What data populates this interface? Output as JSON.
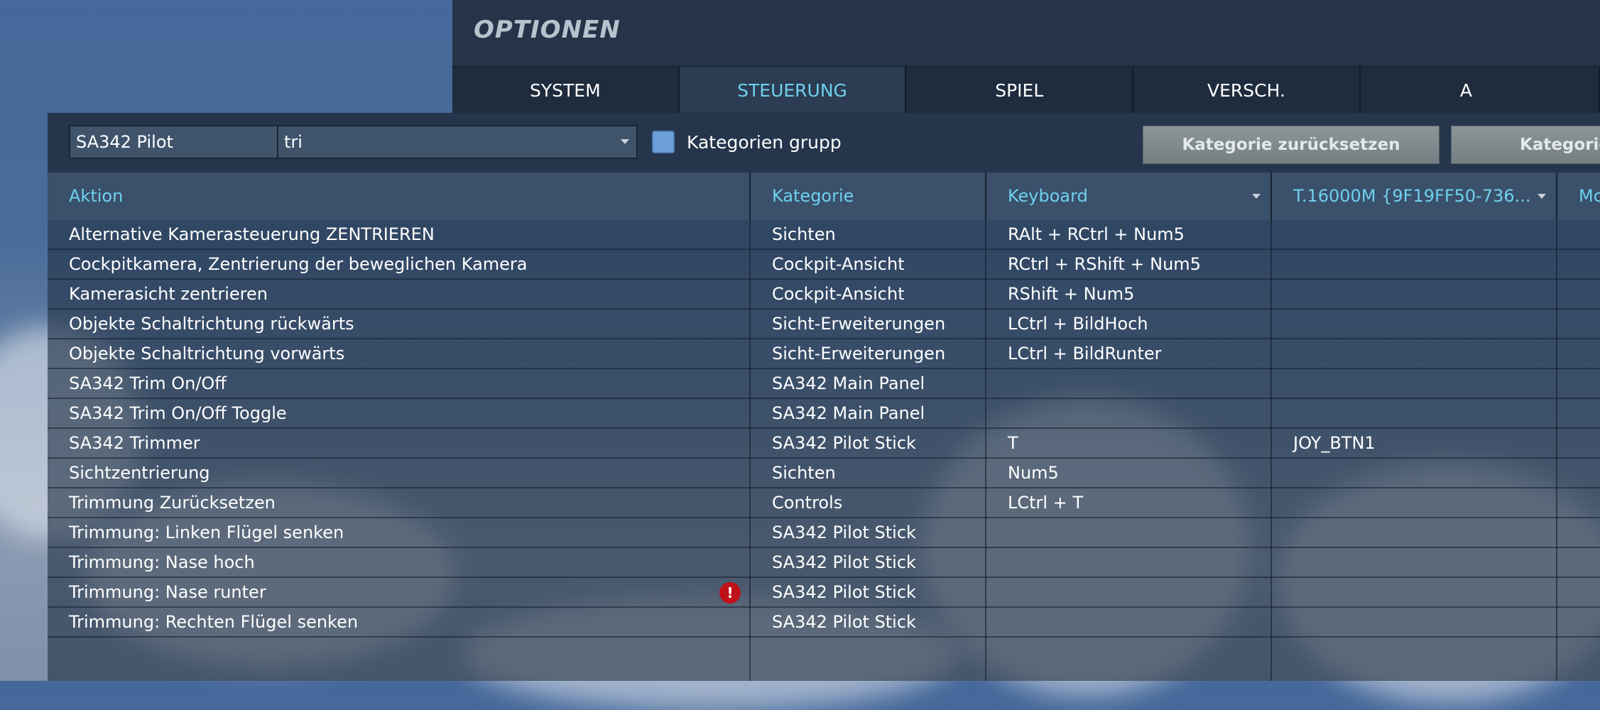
{
  "header": {
    "title": "OPTIONEN"
  },
  "tabs": [
    {
      "label": "SYSTEM",
      "active": false
    },
    {
      "label": "STEUERUNG",
      "active": true
    },
    {
      "label": "SPIEL",
      "active": false
    },
    {
      "label": "VERSCH.",
      "active": false
    },
    {
      "label": "A",
      "active": false
    }
  ],
  "toolbar": {
    "aircraft_select": "SA342 Pilot",
    "filter_select": "tri",
    "group_checkbox_label": "Kategorien grupp",
    "group_checkbox_checked": false,
    "reset_category_button": "Kategorie zurücksetzen",
    "second_category_button": "Kategorie"
  },
  "table": {
    "columns": [
      "Aktion",
      "Kategorie",
      "Keyboard",
      "T.16000M {9F19FF50-736...",
      "Mc"
    ],
    "rows": [
      {
        "action": "Alternative Kamerasteuerung ZENTRIEREN",
        "category": "Sichten",
        "keyboard": "RAlt + RCtrl + Num5",
        "joystick": "",
        "warning": false
      },
      {
        "action": "Cockpitkamera, Zentrierung der beweglichen Kamera",
        "category": "Cockpit-Ansicht",
        "keyboard": "RCtrl + RShift + Num5",
        "joystick": "",
        "warning": false
      },
      {
        "action": "Kamerasicht zentrieren",
        "category": "Cockpit-Ansicht",
        "keyboard": "RShift + Num5",
        "joystick": "",
        "warning": false
      },
      {
        "action": "Objekte Schaltrichtung rückwärts",
        "category": "Sicht-Erweiterungen",
        "keyboard": "LCtrl + BildHoch",
        "joystick": "",
        "warning": false
      },
      {
        "action": "Objekte Schaltrichtung vorwärts",
        "category": "Sicht-Erweiterungen",
        "keyboard": "LCtrl + BildRunter",
        "joystick": "",
        "warning": false
      },
      {
        "action": "SA342 Trim On/Off",
        "category": "SA342 Main Panel",
        "keyboard": "",
        "joystick": "",
        "warning": false
      },
      {
        "action": "SA342 Trim On/Off Toggle",
        "category": "SA342 Main Panel",
        "keyboard": "",
        "joystick": "",
        "warning": false
      },
      {
        "action": "SA342 Trimmer",
        "category": "SA342 Pilot Stick",
        "keyboard": "T",
        "joystick": "JOY_BTN1",
        "warning": false
      },
      {
        "action": "Sichtzentrierung",
        "category": "Sichten",
        "keyboard": "Num5",
        "joystick": "",
        "warning": false
      },
      {
        "action": "Trimmung Zurücksetzen",
        "category": "Controls",
        "keyboard": "LCtrl + T",
        "joystick": "",
        "warning": false
      },
      {
        "action": "Trimmung: Linken Flügel senken",
        "category": "SA342 Pilot Stick",
        "keyboard": "",
        "joystick": "",
        "warning": false
      },
      {
        "action": "Trimmung: Nase hoch",
        "category": "SA342 Pilot Stick",
        "keyboard": "",
        "joystick": "",
        "warning": false
      },
      {
        "action": "Trimmung: Nase runter",
        "category": "SA342 Pilot Stick",
        "keyboard": "",
        "joystick": "",
        "warning": true,
        "warning_symbol": "!"
      },
      {
        "action": "Trimmung: Rechten Flügel senken",
        "category": "SA342 Pilot Stick",
        "keyboard": "",
        "joystick": "",
        "warning": false
      }
    ]
  },
  "colors": {
    "accent": "#6fd0ee",
    "warning": "#c0101a",
    "panel": "#213044",
    "button": "#808b8e"
  },
  "icons": {
    "select_arrow": "dropdown-arrow-icon",
    "warning": "warning-icon"
  }
}
